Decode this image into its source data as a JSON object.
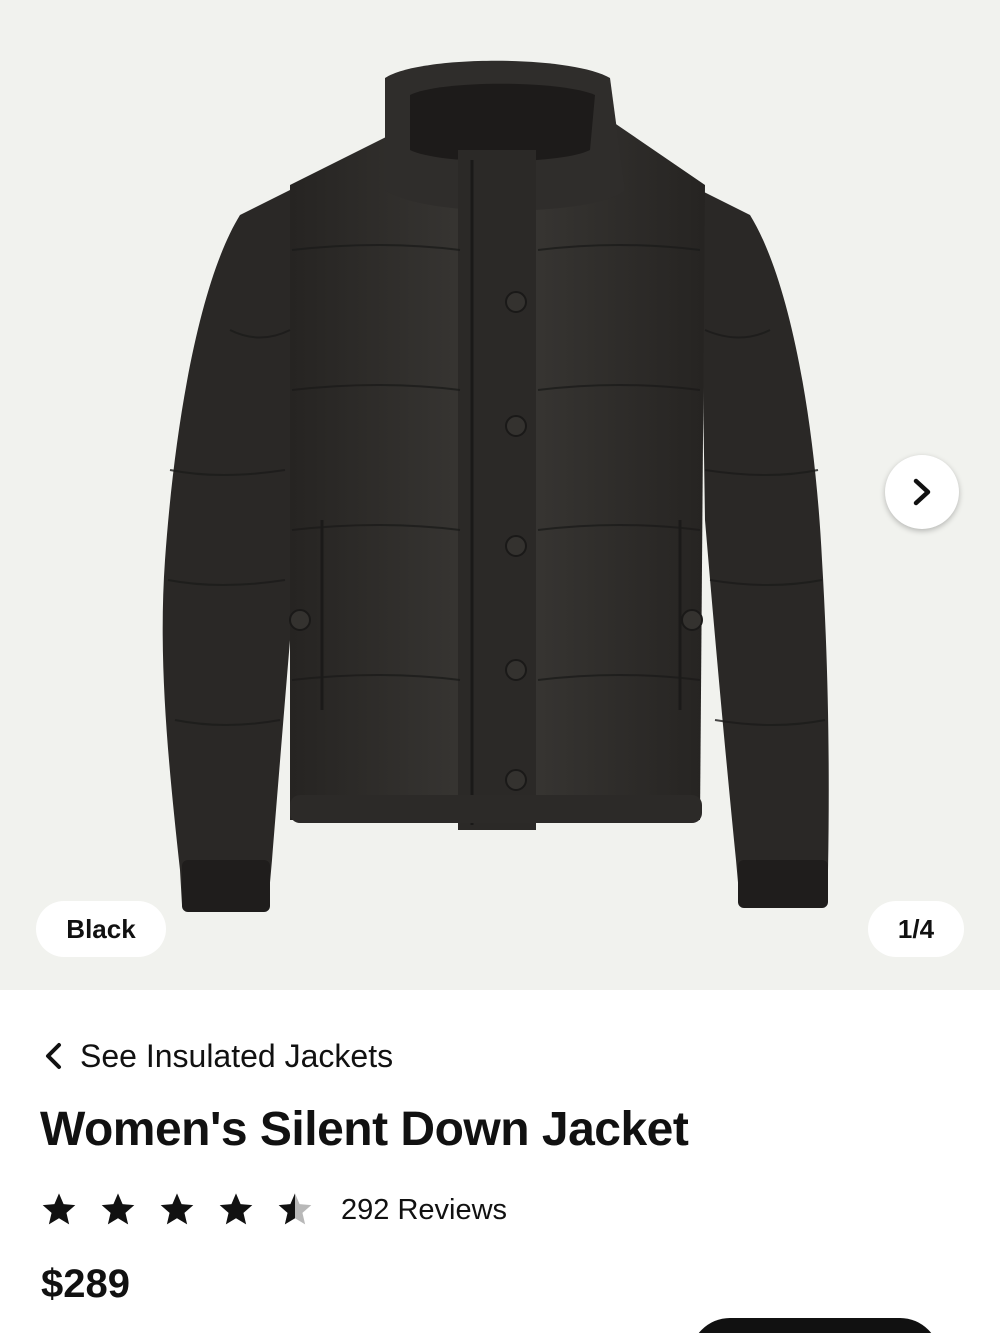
{
  "gallery": {
    "color_label": "Black",
    "image_counter": "1/4",
    "background_color": "#f1f2ee",
    "jacket_color": "#2e2c2a"
  },
  "product": {
    "back_link": "See Insulated Jackets",
    "title": "Women's Silent Down Jacket",
    "rating": 4.5,
    "reviews": "292 Reviews",
    "price": "$289"
  },
  "icons": {
    "next": "chevron-right-icon",
    "back": "chevron-left-icon",
    "star": "star-icon"
  }
}
